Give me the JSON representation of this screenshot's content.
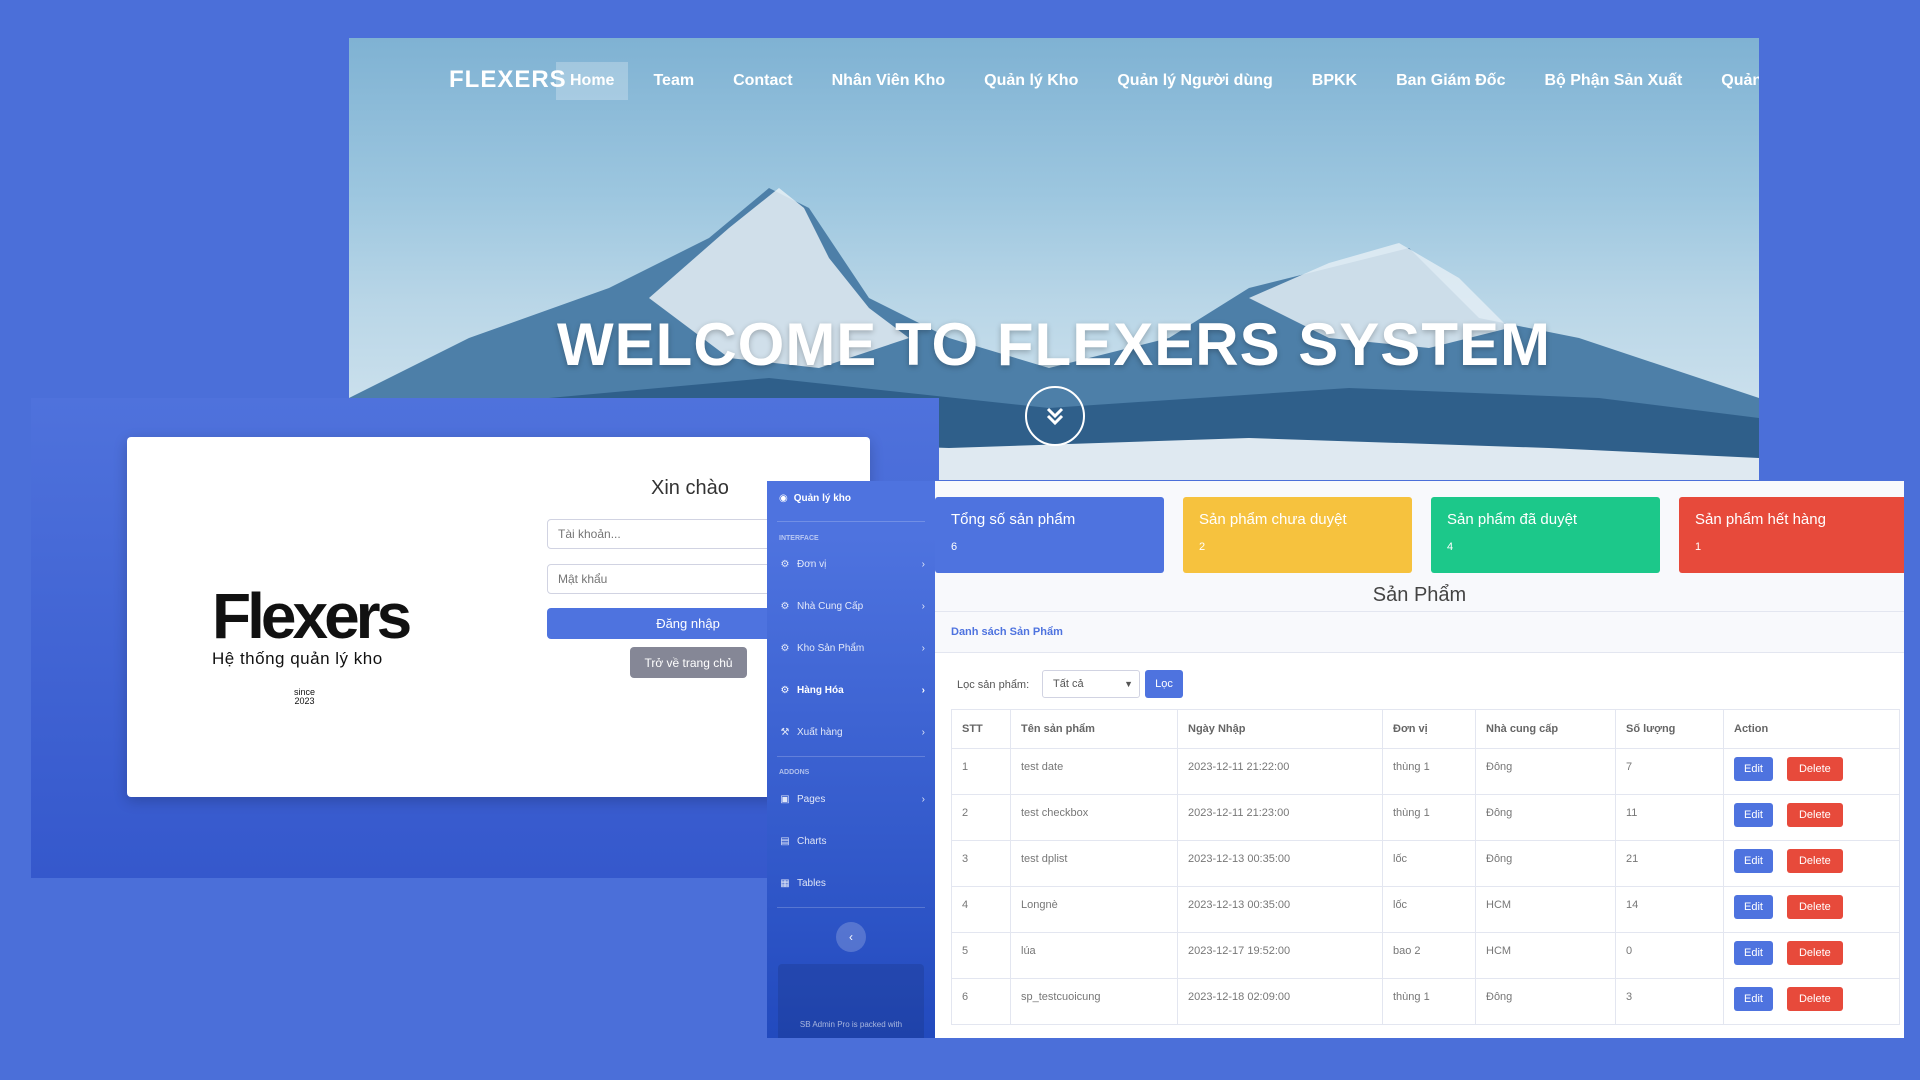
{
  "hero": {
    "brand": "FLEXERS",
    "nav": [
      "Home",
      "Team",
      "Contact",
      "Nhân Viên Kho",
      "Quản lý Kho",
      "Quản lý Người dùng",
      "BPKK",
      "Ban Giám Đốc",
      "Bộ Phận Sản Xuất",
      "Quản Lý Nguy"
    ],
    "active_nav": "Home",
    "title": "WELCOME TO FLEXERS SYSTEM",
    "scroll_icon": "double-chevron-down-icon"
  },
  "login": {
    "logo_word": "Flexers",
    "logo_sub": "Hệ thống quản lý kho",
    "since": "since",
    "year": "2023",
    "title": "Xin chào",
    "username_placeholder": "Tài khoản...",
    "password_placeholder": "Mật khẩu",
    "login_button": "Đăng nhập",
    "home_button": "Trở về trang chủ"
  },
  "admin": {
    "sidebar": {
      "brand": "Quản lý kho",
      "heading_interface": "INTERFACE",
      "heading_addons": "ADDONS",
      "items": [
        {
          "label": "Đơn vị",
          "icon": "gear-icon"
        },
        {
          "label": "Nhà Cung Cấp",
          "icon": "gear-icon"
        },
        {
          "label": "Kho Sản Phẩm",
          "icon": "gear-icon"
        },
        {
          "label": "Hàng Hóa",
          "icon": "gear-icon"
        },
        {
          "label": "Xuất hàng",
          "icon": "wrench-icon"
        }
      ],
      "addon_items": [
        {
          "label": "Pages",
          "icon": "folder-icon"
        },
        {
          "label": "Charts",
          "icon": "chart-icon"
        },
        {
          "label": "Tables",
          "icon": "table-icon"
        }
      ],
      "promo": "SB Admin Pro is packed with"
    },
    "cards": [
      {
        "title": "Tổng số sản phẩm",
        "value": "6",
        "color": "#4e73df"
      },
      {
        "title": "Sản phẩm chưa duyệt",
        "value": "2",
        "color": "#f6c23e"
      },
      {
        "title": "Sản phẩm đã duyệt",
        "value": "4",
        "color": "#1cc88a"
      },
      {
        "title": "Sản phẩm hết hàng",
        "value": "1",
        "color": "#e74a3b"
      }
    ],
    "page_title": "Sản Phẩm",
    "panel_title": "Danh sách Sản Phẩm",
    "filter_label": "Lọc sản phẩm:",
    "filter_value": "Tất cả",
    "filter_button": "Lọc",
    "columns": [
      "STT",
      "Tên sản phẩm",
      "Ngày Nhập",
      "Đơn vị",
      "Nhà cung cấp",
      "Số lượng",
      "Action"
    ],
    "edit_label": "Edit",
    "delete_label": "Delete",
    "rows": [
      [
        "1",
        "test date",
        "2023-12-11 21:22:00",
        "thùng 1",
        "Đông",
        "7"
      ],
      [
        "2",
        "test checkbox",
        "2023-12-11 21:23:00",
        "thùng 1",
        "Đông",
        "11"
      ],
      [
        "3",
        "test dplist",
        "2023-12-13 00:35:00",
        "lốc",
        "Đông",
        "21"
      ],
      [
        "4",
        "Longnè",
        "2023-12-13 00:35:00",
        "lốc",
        "HCM",
        "14"
      ],
      [
        "5",
        "lúa",
        "2023-12-17 19:52:00",
        "bao 2",
        "HCM",
        "0"
      ],
      [
        "6",
        "sp_testcuoicung",
        "2023-12-18 02:09:00",
        "thùng 1",
        "Đông",
        "3"
      ]
    ]
  }
}
